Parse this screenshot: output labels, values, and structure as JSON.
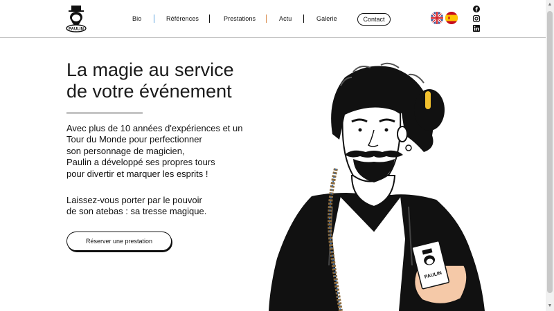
{
  "logo": {
    "text": "PAULIN"
  },
  "nav": {
    "items": [
      {
        "label": "Bio"
      },
      {
        "label": "Références"
      },
      {
        "label": "Prestations"
      },
      {
        "label": "Actu"
      },
      {
        "label": "Galerie"
      }
    ],
    "contact_label": "Contact",
    "separator_colors": [
      "#5aa2de",
      "#111111",
      "#d8894a",
      "#111111"
    ]
  },
  "languages": [
    {
      "icon": "uk-flag-icon"
    },
    {
      "icon": "spain-flag-icon"
    }
  ],
  "social": [
    "facebook-icon",
    "instagram-icon",
    "linkedin-icon"
  ],
  "hero": {
    "title_line1": "La magie au service",
    "title_line2": "de votre événement",
    "paragraph1": [
      "Avec plus de 10 années d'expériences et un",
      "Tour du Monde pour perfectionner",
      "son personnage de magicien,",
      "Paulin a développé ses propres tours",
      "pour divertir et marquer les esprits !"
    ],
    "paragraph2": [
      "Laissez-vous porter par le pouvoir",
      "de son atebas : sa tresse magique."
    ],
    "cta_label": "Réserver une prestation",
    "card_text": "PAULIN"
  },
  "colors": {
    "text": "#111111",
    "divider": "#bdbdbd",
    "jacket": "#111111",
    "hair_tie": "#f2c12e"
  }
}
